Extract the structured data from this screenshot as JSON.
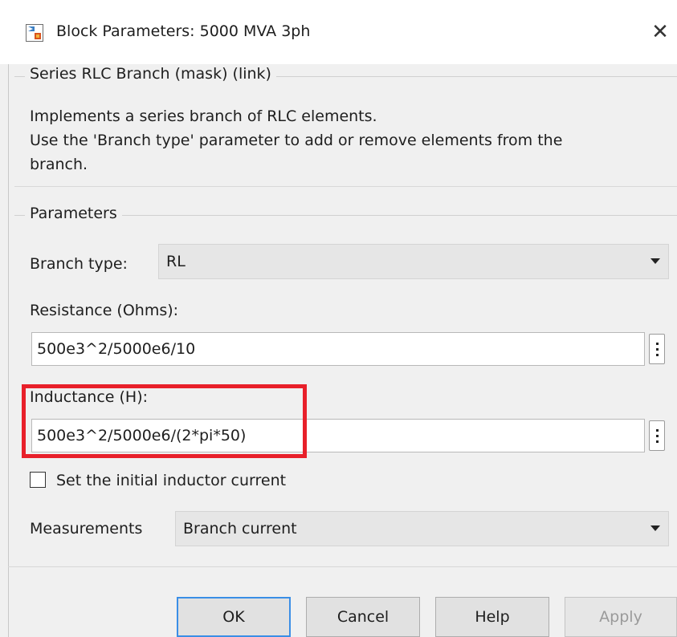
{
  "window": {
    "title": "Block Parameters: 5000 MVA 3ph",
    "close_glyph": "✕"
  },
  "mask": {
    "group_label": "Series RLC Branch (mask) (link)",
    "description": [
      "Implements a series branch of RLC elements.",
      "Use the 'Branch type' parameter to add or remove elements from the",
      "branch."
    ]
  },
  "parameters": {
    "group_label": "Parameters",
    "branch_type": {
      "label": "Branch type:",
      "value": "RL"
    },
    "resistance": {
      "label": "Resistance (Ohms):",
      "value": "500e3^2/5000e6/10"
    },
    "inductance": {
      "label": "Inductance (H):",
      "value": "500e3^2/5000e6/(2*pi*50)"
    },
    "initial_current": {
      "label": "Set the initial inductor current",
      "checked": false
    },
    "measurements": {
      "label": "Measurements",
      "value": "Branch current"
    }
  },
  "buttons": {
    "ok": "OK",
    "cancel": "Cancel",
    "help": "Help",
    "apply": "Apply"
  },
  "colors": {
    "highlight_box": "#e8202a",
    "default_button_border": "#3a8ee6",
    "dialog_background": "#f0f0f0"
  }
}
